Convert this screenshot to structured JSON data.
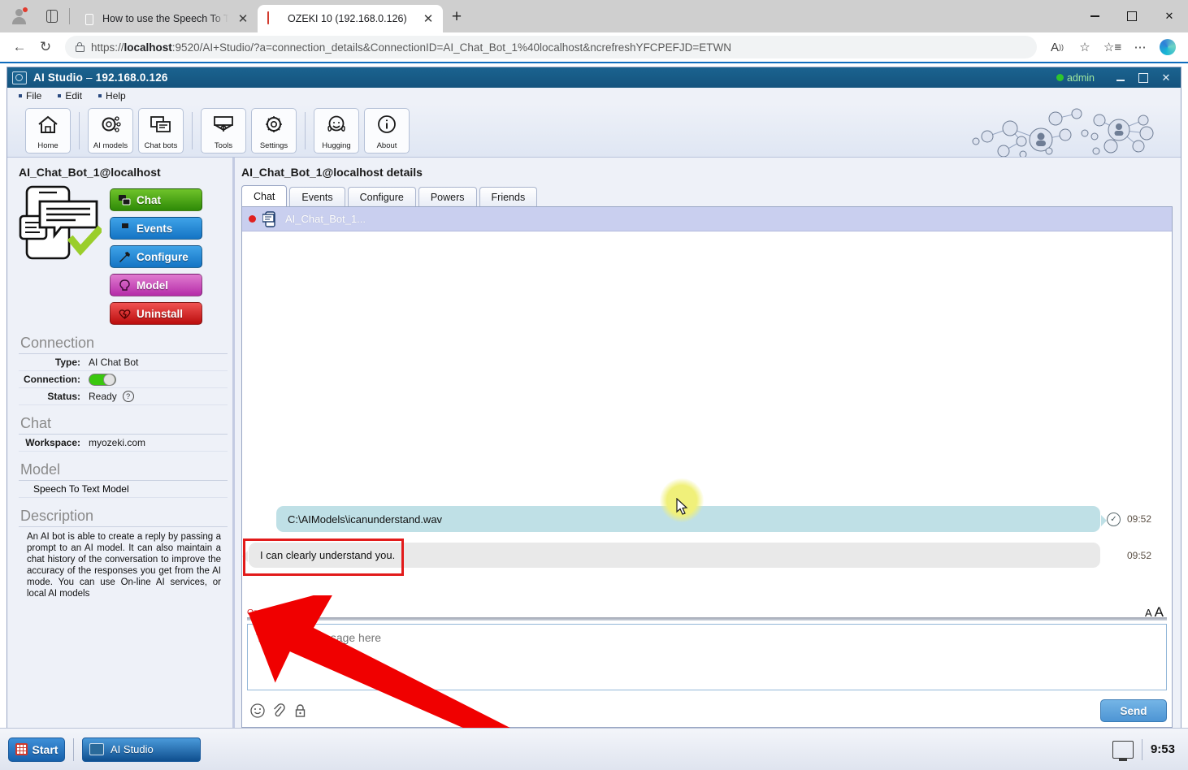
{
  "browser": {
    "tabs": [
      {
        "title": "How to use the Speech To Text m",
        "favicon": "book-icon",
        "active": false
      },
      {
        "title": "OZEKI 10 (192.168.0.126)",
        "favicon": "ozeki-icon",
        "active": true
      }
    ],
    "new_tab_label": "+",
    "close_glyph": "✕",
    "nav": {
      "back": "←",
      "reload": "↻"
    },
    "url": "https://localhost:9520/AI+Studio/?a=connection_details&ConnectionID=AI_Chat_Bot_1%40localhost&ncrefreshYFCPEFJD=ETWN",
    "url_bold": "localhost",
    "toolbar_icons": [
      "read-aloud-icon",
      "favorite-star-icon",
      "collections-icon",
      "more-options-icon",
      "copilot-icon"
    ],
    "window_controls": {
      "minimize": "minimize-icon",
      "maximize": "maximize-icon",
      "close": "✕"
    }
  },
  "app": {
    "title": "AI Studio",
    "title_dash": " – ",
    "host": "192.168.0.126",
    "user": "admin",
    "window_controls": {
      "minimize": "minimize-icon",
      "maximize": "maximize-icon",
      "close": "✕"
    },
    "menu": [
      "File",
      "Edit",
      "Help"
    ],
    "toolbar": [
      {
        "label": "Home",
        "icon": "home-icon",
        "group": 0
      },
      {
        "label": "AI models",
        "icon": "gear-network-icon",
        "group": 1
      },
      {
        "label": "Chat bots",
        "icon": "chatbots-icon",
        "group": 1
      },
      {
        "label": "Tools",
        "icon": "tools-icon",
        "group": 2
      },
      {
        "label": "Settings",
        "icon": "gear-icon",
        "group": 2
      },
      {
        "label": "Hugging",
        "icon": "hugging-face-icon",
        "group": 3
      },
      {
        "label": "About",
        "icon": "info-icon",
        "group": 3
      }
    ]
  },
  "left": {
    "title": "AI_Chat_Bot_1@localhost",
    "illustration": "chat-bot-illustration",
    "buttons": [
      {
        "label": "Chat",
        "color": "green",
        "icon": "chat-icon"
      },
      {
        "label": "Events",
        "color": "blue",
        "icon": "flag-icon"
      },
      {
        "label": "Configure",
        "color": "blue",
        "icon": "wrench-icon"
      },
      {
        "label": "Model",
        "color": "pink",
        "icon": "brain-icon"
      },
      {
        "label": "Uninstall",
        "color": "red",
        "icon": "broken-heart-icon"
      }
    ],
    "sections": {
      "connection": {
        "heading": "Connection",
        "rows": [
          {
            "key": "Type:",
            "value": "AI Chat Bot",
            "kind": "text"
          },
          {
            "key": "Connection:",
            "value": "",
            "kind": "toggle-on"
          },
          {
            "key": "Status:",
            "value": "Ready",
            "kind": "text-help"
          }
        ]
      },
      "chat": {
        "heading": "Chat",
        "rows": [
          {
            "key": "Workspace:",
            "value": "myozeki.com",
            "kind": "text"
          }
        ]
      },
      "model": {
        "heading": "Model",
        "value": "Speech To Text Model"
      },
      "description": {
        "heading": "Description",
        "text": "An AI bot is able to create a reply by passing a prompt to an AI model. It can also maintain a chat history of the conversation to improve the accuracy of the responses you get from the AI mode. You can use On-line AI services, or local AI models"
      }
    }
  },
  "right": {
    "title": "AI_Chat_Bot_1@localhost details",
    "tabs": [
      {
        "label": "Chat",
        "active": true
      },
      {
        "label": "Events",
        "active": false
      },
      {
        "label": "Configure",
        "active": false
      },
      {
        "label": "Powers",
        "active": false
      },
      {
        "label": "Friends",
        "active": false
      }
    ],
    "conversation": {
      "status": "offline-dot",
      "icon": "chatbot-icon",
      "name": "AI_Chat_Bot_1..."
    },
    "messages": [
      {
        "direction": "out",
        "text": "C:\\AIModels\\icanunderstand.wav",
        "time": "09:52",
        "status": "delivered-check"
      },
      {
        "direction": "in",
        "text": "I can clearly understand you.",
        "time": "09:52",
        "status": ""
      }
    ],
    "sender_label": "Ozeki",
    "fontsize_control": {
      "small": "A",
      "large": "A"
    },
    "compose_placeholder": "Type your message here",
    "compose_value": "",
    "compose_icons": [
      "emoji-icon",
      "attachment-icon",
      "lock-icon"
    ],
    "send_label": "Send"
  },
  "annotations": {
    "highlight_target": "I can clearly understand you.",
    "highlight_color": "#e21b1b",
    "arrow_color": "#f00000",
    "cursor_highlight_color": "#f0f07a"
  },
  "taskbar": {
    "start_label": "Start",
    "tasks": [
      {
        "label": "AI Studio",
        "icon": "ozeki-app-icon"
      }
    ],
    "tray_icon": "show-desktop-icon",
    "clock": "9:53"
  }
}
